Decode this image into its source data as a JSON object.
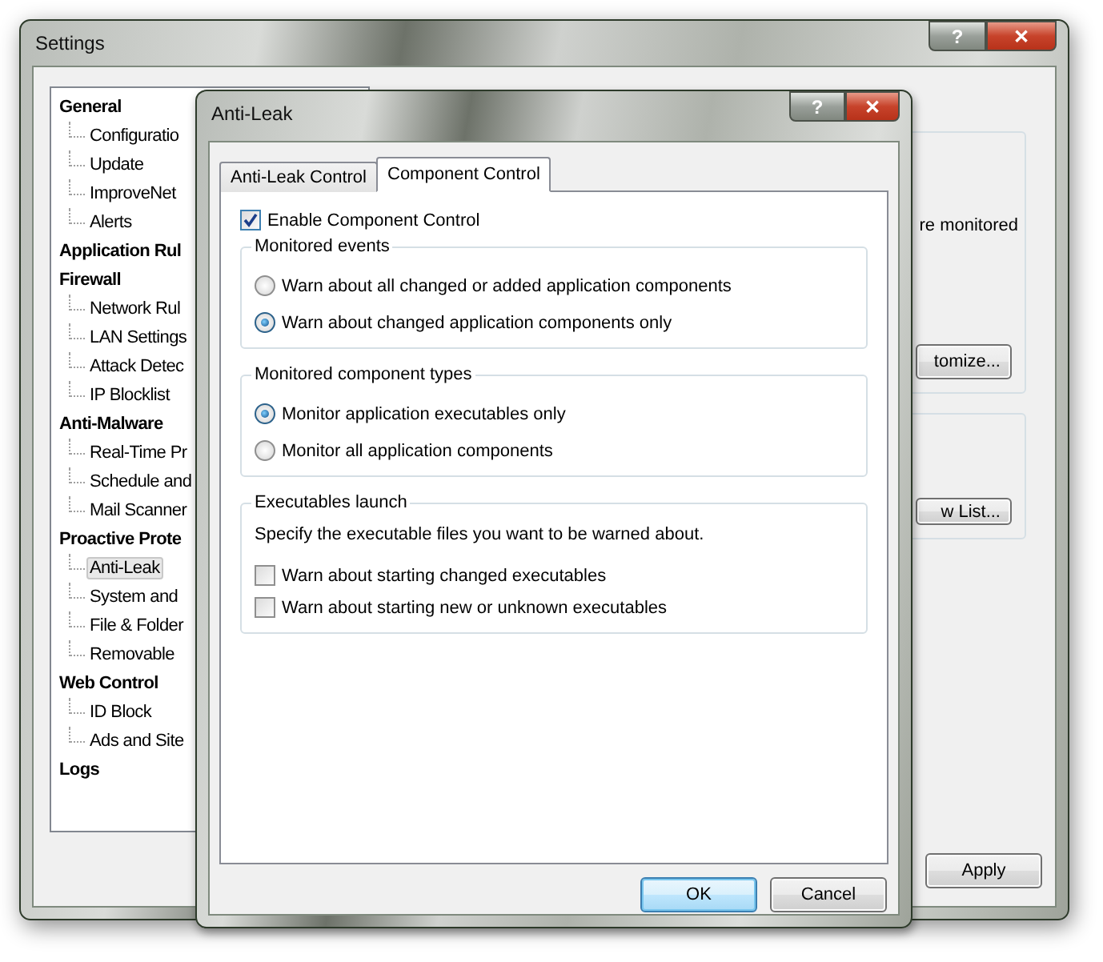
{
  "settings_window": {
    "title": "Settings",
    "title_buttons": [
      "?",
      "✕"
    ],
    "tree": [
      {
        "label": "General",
        "selected": false,
        "children": [
          {
            "label": "Configuratio",
            "selected": false
          },
          {
            "label": "Update",
            "selected": false
          },
          {
            "label": "ImproveNet",
            "selected": false
          },
          {
            "label": "Alerts",
            "selected": false
          }
        ]
      },
      {
        "label": "Application Rul",
        "selected": false
      },
      {
        "label": "Firewall",
        "selected": false,
        "children": [
          {
            "label": "Network Rul",
            "selected": false
          },
          {
            "label": "LAN Settings",
            "selected": false
          },
          {
            "label": "Attack Detec",
            "selected": false
          },
          {
            "label": "IP Blocklist",
            "selected": false
          }
        ]
      },
      {
        "label": "Anti-Malware",
        "selected": false,
        "children": [
          {
            "label": "Real-Time Pr",
            "selected": false
          },
          {
            "label": "Schedule and",
            "selected": false
          },
          {
            "label": "Mail Scanner",
            "selected": false
          }
        ]
      },
      {
        "label": "Proactive Prote",
        "selected": false,
        "children": [
          {
            "label": "Anti-Leak",
            "selected": true
          },
          {
            "label": "System and",
            "selected": false
          },
          {
            "label": "File & Folder",
            "selected": false
          },
          {
            "label": "Removable",
            "selected": false
          }
        ]
      },
      {
        "label": "Web Control",
        "selected": false,
        "children": [
          {
            "label": "ID Block",
            "selected": false
          },
          {
            "label": "Ads and Site",
            "selected": false
          }
        ]
      },
      {
        "label": "Logs",
        "selected": false
      }
    ],
    "groups": [
      {
        "text": "re monitored",
        "button": "tomize..."
      },
      {
        "button": "w List..."
      }
    ],
    "apply_button": "Apply"
  },
  "dialog": {
    "title": "Anti-Leak",
    "title_buttons": [
      "?",
      "✕"
    ],
    "tabs": [
      {
        "label": "Anti-Leak Control",
        "selected": false
      },
      {
        "label": "Component Control",
        "selected": true
      }
    ],
    "enable_checkbox": {
      "label": "Enable Component Control",
      "checked": true
    },
    "groups": [
      {
        "title": "Monitored events",
        "kind": "radio",
        "options": [
          {
            "label": "Warn about all changed or added application components",
            "selected": false
          },
          {
            "label": "Warn about changed application components only",
            "selected": true
          }
        ]
      },
      {
        "title": "Monitored component types",
        "kind": "radio",
        "options": [
          {
            "label": "Monitor application executables only",
            "selected": true
          },
          {
            "label": "Monitor all application components",
            "selected": false
          }
        ]
      },
      {
        "title": "Executables launch",
        "kind": "checkbox",
        "description": "Specify the executable files you want to be warned about.",
        "options": [
          {
            "label": "Warn about starting changed executables",
            "checked": false
          },
          {
            "label": "Warn about starting new or unknown executables",
            "checked": false
          }
        ]
      }
    ],
    "buttons": [
      {
        "label": "OK",
        "default": true
      },
      {
        "label": "Cancel",
        "default": false
      }
    ]
  }
}
